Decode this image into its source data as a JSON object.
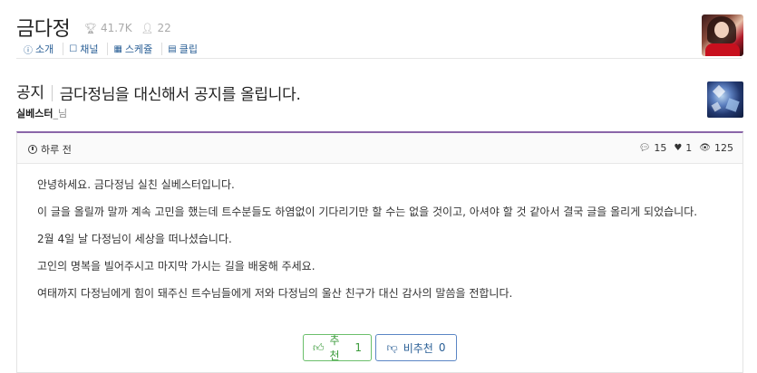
{
  "channel": {
    "title": "금다정",
    "followers": "41.7K",
    "members": "22",
    "tabs": [
      {
        "icon": "info-icon",
        "glyph": "i",
        "label": "소개"
      },
      {
        "icon": "chat-icon",
        "glyph": "□",
        "label": "채널"
      },
      {
        "icon": "calendar-icon",
        "glyph": "▦",
        "label": "스케쥴"
      },
      {
        "icon": "film-icon",
        "glyph": "▤",
        "label": "클립"
      }
    ]
  },
  "post": {
    "category": "공지",
    "title": "금다정님을 대신해서 공지를 올립니다.",
    "author": "실베스터",
    "author_suffix": "_님",
    "time": "하루 전",
    "comments": "15",
    "likes": "1",
    "views": "125",
    "paragraphs": [
      "안녕하세요. 금다정님 실친 실베스터입니다.",
      "이 글을 올릴까 말까 계속 고민을 했는데 트수분들도 하염없이 기다리기만 할 수는 없을 것이고, 아셔야 할 것 같아서 결국 글을 올리게 되었습니다.",
      "2월 4일 날 다정님이 세상을 떠나셨습니다.",
      "고인의 명복을 빌어주시고 마지막 가시는 길을 배웅해 주세요.",
      "여태까지 다정님에게 힘이 돼주신 트수님들에게 저와 다정님의 울산 친구가 대신 감사의 말씀을 전합니다."
    ],
    "upvote_label": "추천",
    "upvote_count": "1",
    "downvote_label": "비추천",
    "downvote_count": "0"
  },
  "colors": {
    "accent": "#8a65a8",
    "link": "#2a5f96",
    "upvote": "#3c9b3c",
    "downvote": "#2a5f96"
  }
}
